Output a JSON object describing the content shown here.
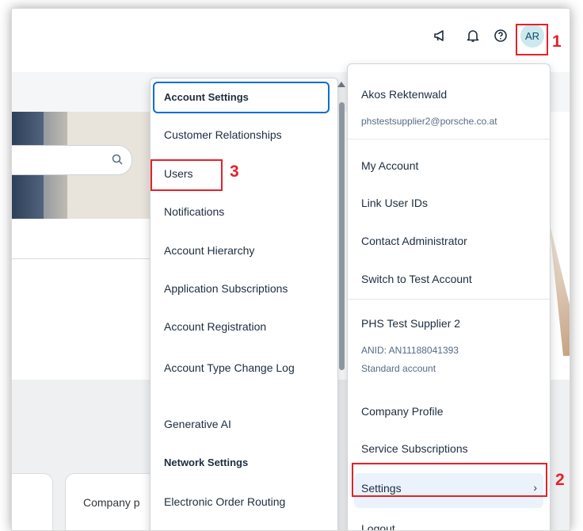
{
  "header": {
    "icons": [
      "megaphone-icon",
      "bell-icon",
      "help-icon"
    ],
    "avatar_initials": "AR"
  },
  "background": {
    "card_label": "Company p"
  },
  "account_menu": {
    "user_name": "Akos Rektenwald",
    "user_email": "phstestsupplier2@porsche.co.at",
    "items_top": [
      "My Account",
      "Link User IDs",
      "Contact Administrator",
      "Switch to Test Account"
    ],
    "company_name": "PHS Test Supplier 2",
    "anid": "ANID: AN11188041393",
    "account_type": "Standard account",
    "items_bottom": [
      "Company Profile",
      "Service Subscriptions",
      "Settings",
      "Logout"
    ]
  },
  "settings_menu": {
    "heading_account": "Account Settings",
    "items": [
      "Customer Relationships",
      "Users",
      "Notifications",
      "Account Hierarchy",
      "Application Subscriptions",
      "Account Registration",
      "Account Type Change Log",
      "Generative AI"
    ],
    "heading_network": "Network Settings",
    "network_items": [
      "Electronic Order Routing"
    ]
  },
  "annotations": {
    "marker_1": "1",
    "marker_2": "2",
    "marker_3": "3",
    "color": "#e5212a"
  }
}
